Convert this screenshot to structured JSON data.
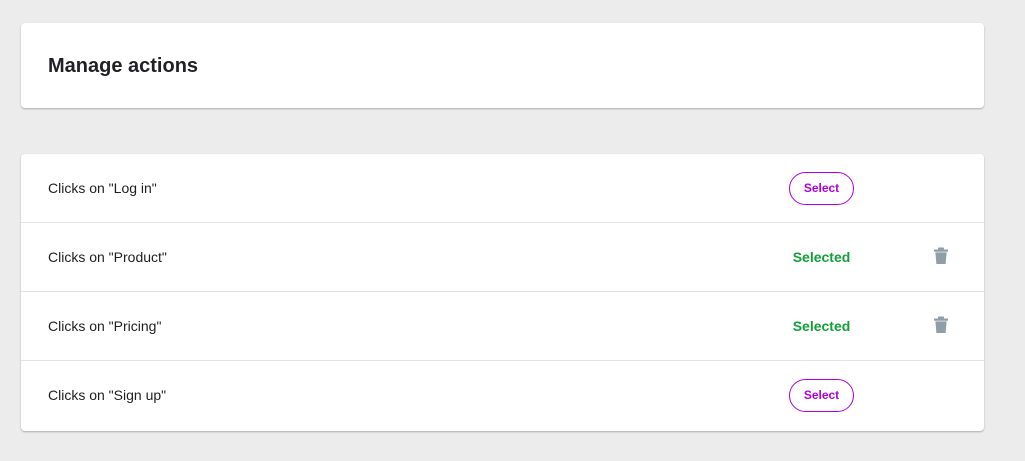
{
  "header": {
    "title": "Manage actions"
  },
  "actions": {
    "rows": [
      {
        "label": "Clicks on \"Log in\"",
        "select_label": "Select",
        "status": ""
      },
      {
        "label": "Clicks on \"Product\"",
        "select_label": "",
        "status": "Selected",
        "delete_icon": "trash-icon"
      },
      {
        "label": "Clicks on \"Pricing\"",
        "select_label": "",
        "status": "Selected",
        "delete_icon": "trash-icon"
      },
      {
        "label": "Clicks on \"Sign up\"",
        "select_label": "Select",
        "status": ""
      }
    ]
  },
  "colors": {
    "page_background": "#ececec",
    "card_background": "#ffffff",
    "accent_purple": "#b000e0",
    "selected_green": "#129f3a",
    "trash_gray": "#8f9ea7"
  }
}
